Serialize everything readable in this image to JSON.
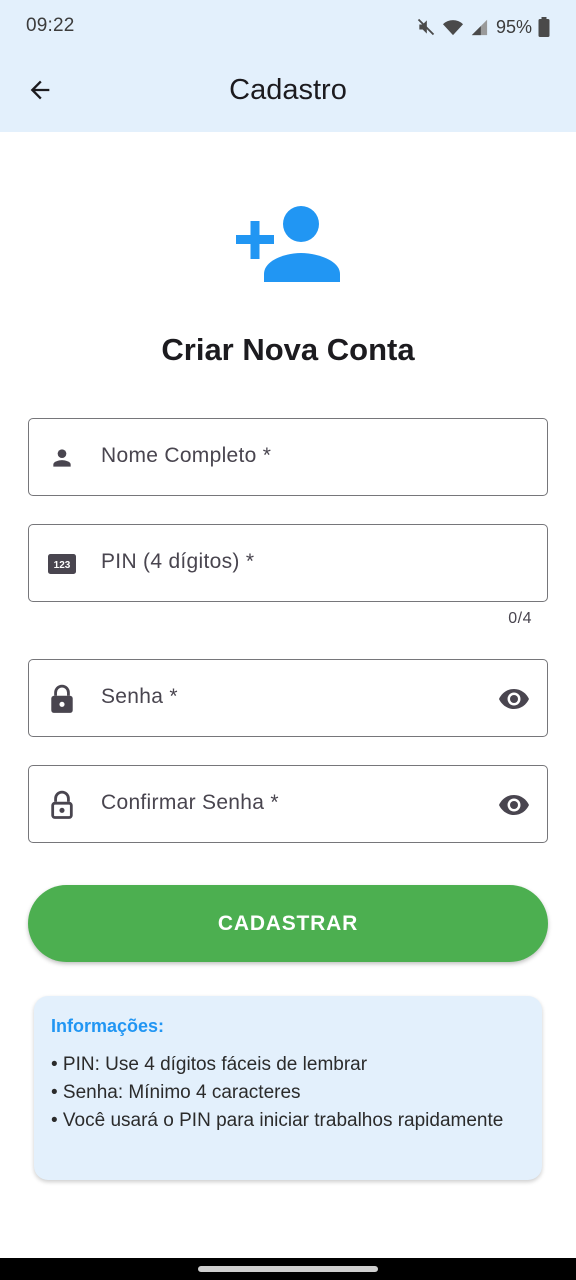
{
  "status_bar": {
    "time": "09:22",
    "battery": "95%",
    "icons": [
      "mute-icon",
      "wifi-icon",
      "signal-icon",
      "battery-icon"
    ]
  },
  "app_bar": {
    "title": "Cadastro",
    "back_icon": "arrow-back-icon"
  },
  "hero": {
    "icon": "person-add-icon",
    "title": "Criar Nova Conta"
  },
  "form": {
    "name_field": {
      "label": "Nome Completo *",
      "value": "",
      "icon": "person-icon"
    },
    "pin_field": {
      "label": "PIN (4 dígitos) *",
      "value": "",
      "icon": "pin-123-icon",
      "counter": "0/4"
    },
    "password_field": {
      "label": "Senha *",
      "value": "",
      "icon": "lock-icon",
      "toggle_icon": "eye-icon"
    },
    "confirm_field": {
      "label": "Confirmar Senha *",
      "value": "",
      "icon": "lock-outline-icon",
      "toggle_icon": "eye-icon"
    },
    "submit_label": "CADASTRAR"
  },
  "info": {
    "title": "Informações:",
    "lines": [
      "• PIN: Use 4 dígitos fáceis de lembrar",
      "• Senha: Mínimo 4 caracteres",
      "• Você usará o PIN para iniciar trabalhos rapidamente"
    ]
  },
  "colors": {
    "app_bar_bg": "#e3f0fc",
    "accent_blue": "#2196f3",
    "button_green": "#4caf50",
    "outline": "#76767a"
  }
}
